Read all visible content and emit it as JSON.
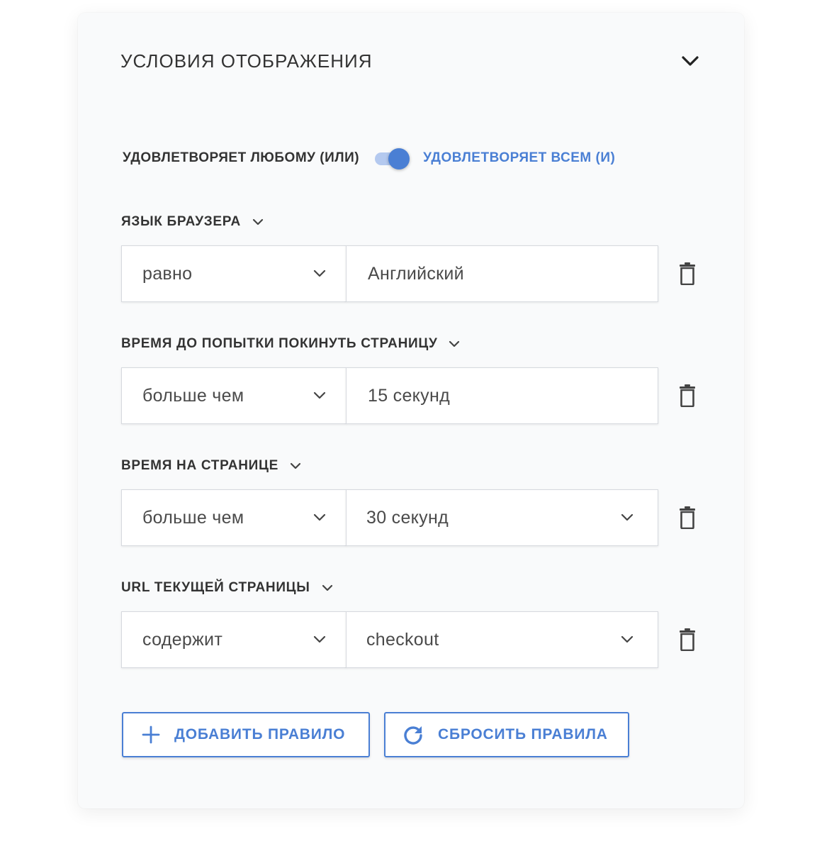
{
  "panel": {
    "title": "УСЛОВИЯ ОТОБРАЖЕНИЯ",
    "collapse_icon": "chevron-down-icon"
  },
  "logic": {
    "any_label": "УДОВЛЕТВОРЯЕТ ЛЮБОМУ (ИЛИ)",
    "all_label": "УДОВЛЕТВОРЯЕТ ВСЕМ (И)",
    "selected": "all",
    "accent_color": "#4a7fd4"
  },
  "rules": [
    {
      "label": "ЯЗЫК БРАУЗЕРА",
      "operator": "равно",
      "value": "Английский",
      "value_has_dropdown": false
    },
    {
      "label": "ВРЕМЯ ДО ПОПЫТКИ ПОКИНУТЬ СТРАНИЦУ",
      "operator": "больше чем",
      "value": "15 секунд",
      "value_has_dropdown": false
    },
    {
      "label": "ВРЕМЯ НА СТРАНИЦЕ",
      "operator": "больше чем",
      "value": "30 секунд",
      "value_has_dropdown": true
    },
    {
      "label": "URL ТЕКУЩЕЙ СТРАНИЦЫ",
      "operator": "содержит",
      "value": "checkout",
      "value_has_dropdown": true
    }
  ],
  "actions": {
    "add_label": "ДОБАВИТЬ ПРАВИЛО",
    "add_icon": "plus-icon",
    "reset_label": "СБРОСИТЬ ПРАВИЛА",
    "reset_icon": "refresh-icon"
  }
}
